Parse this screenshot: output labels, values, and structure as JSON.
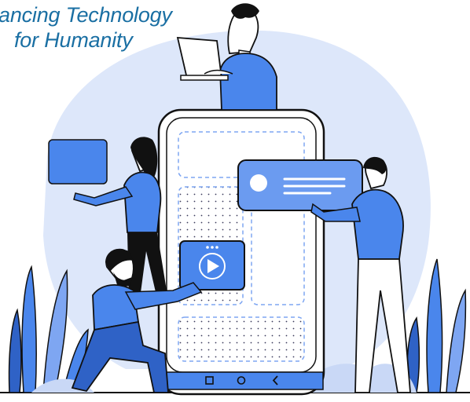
{
  "tagline": {
    "line1": "ancing Technology",
    "line2": "for Humanity"
  },
  "colors": {
    "blob": "#dde7fa",
    "accent": "#4a86ec",
    "accent_dark": "#2f62c6",
    "ink": "#111111",
    "brand_text": "#1a6fa3"
  },
  "phone_nav_icons": [
    "square-icon",
    "circle-icon",
    "back-chevron-icon"
  ],
  "video_card": {
    "icon": "play-icon",
    "menu_icon": "three-dots-icon"
  }
}
